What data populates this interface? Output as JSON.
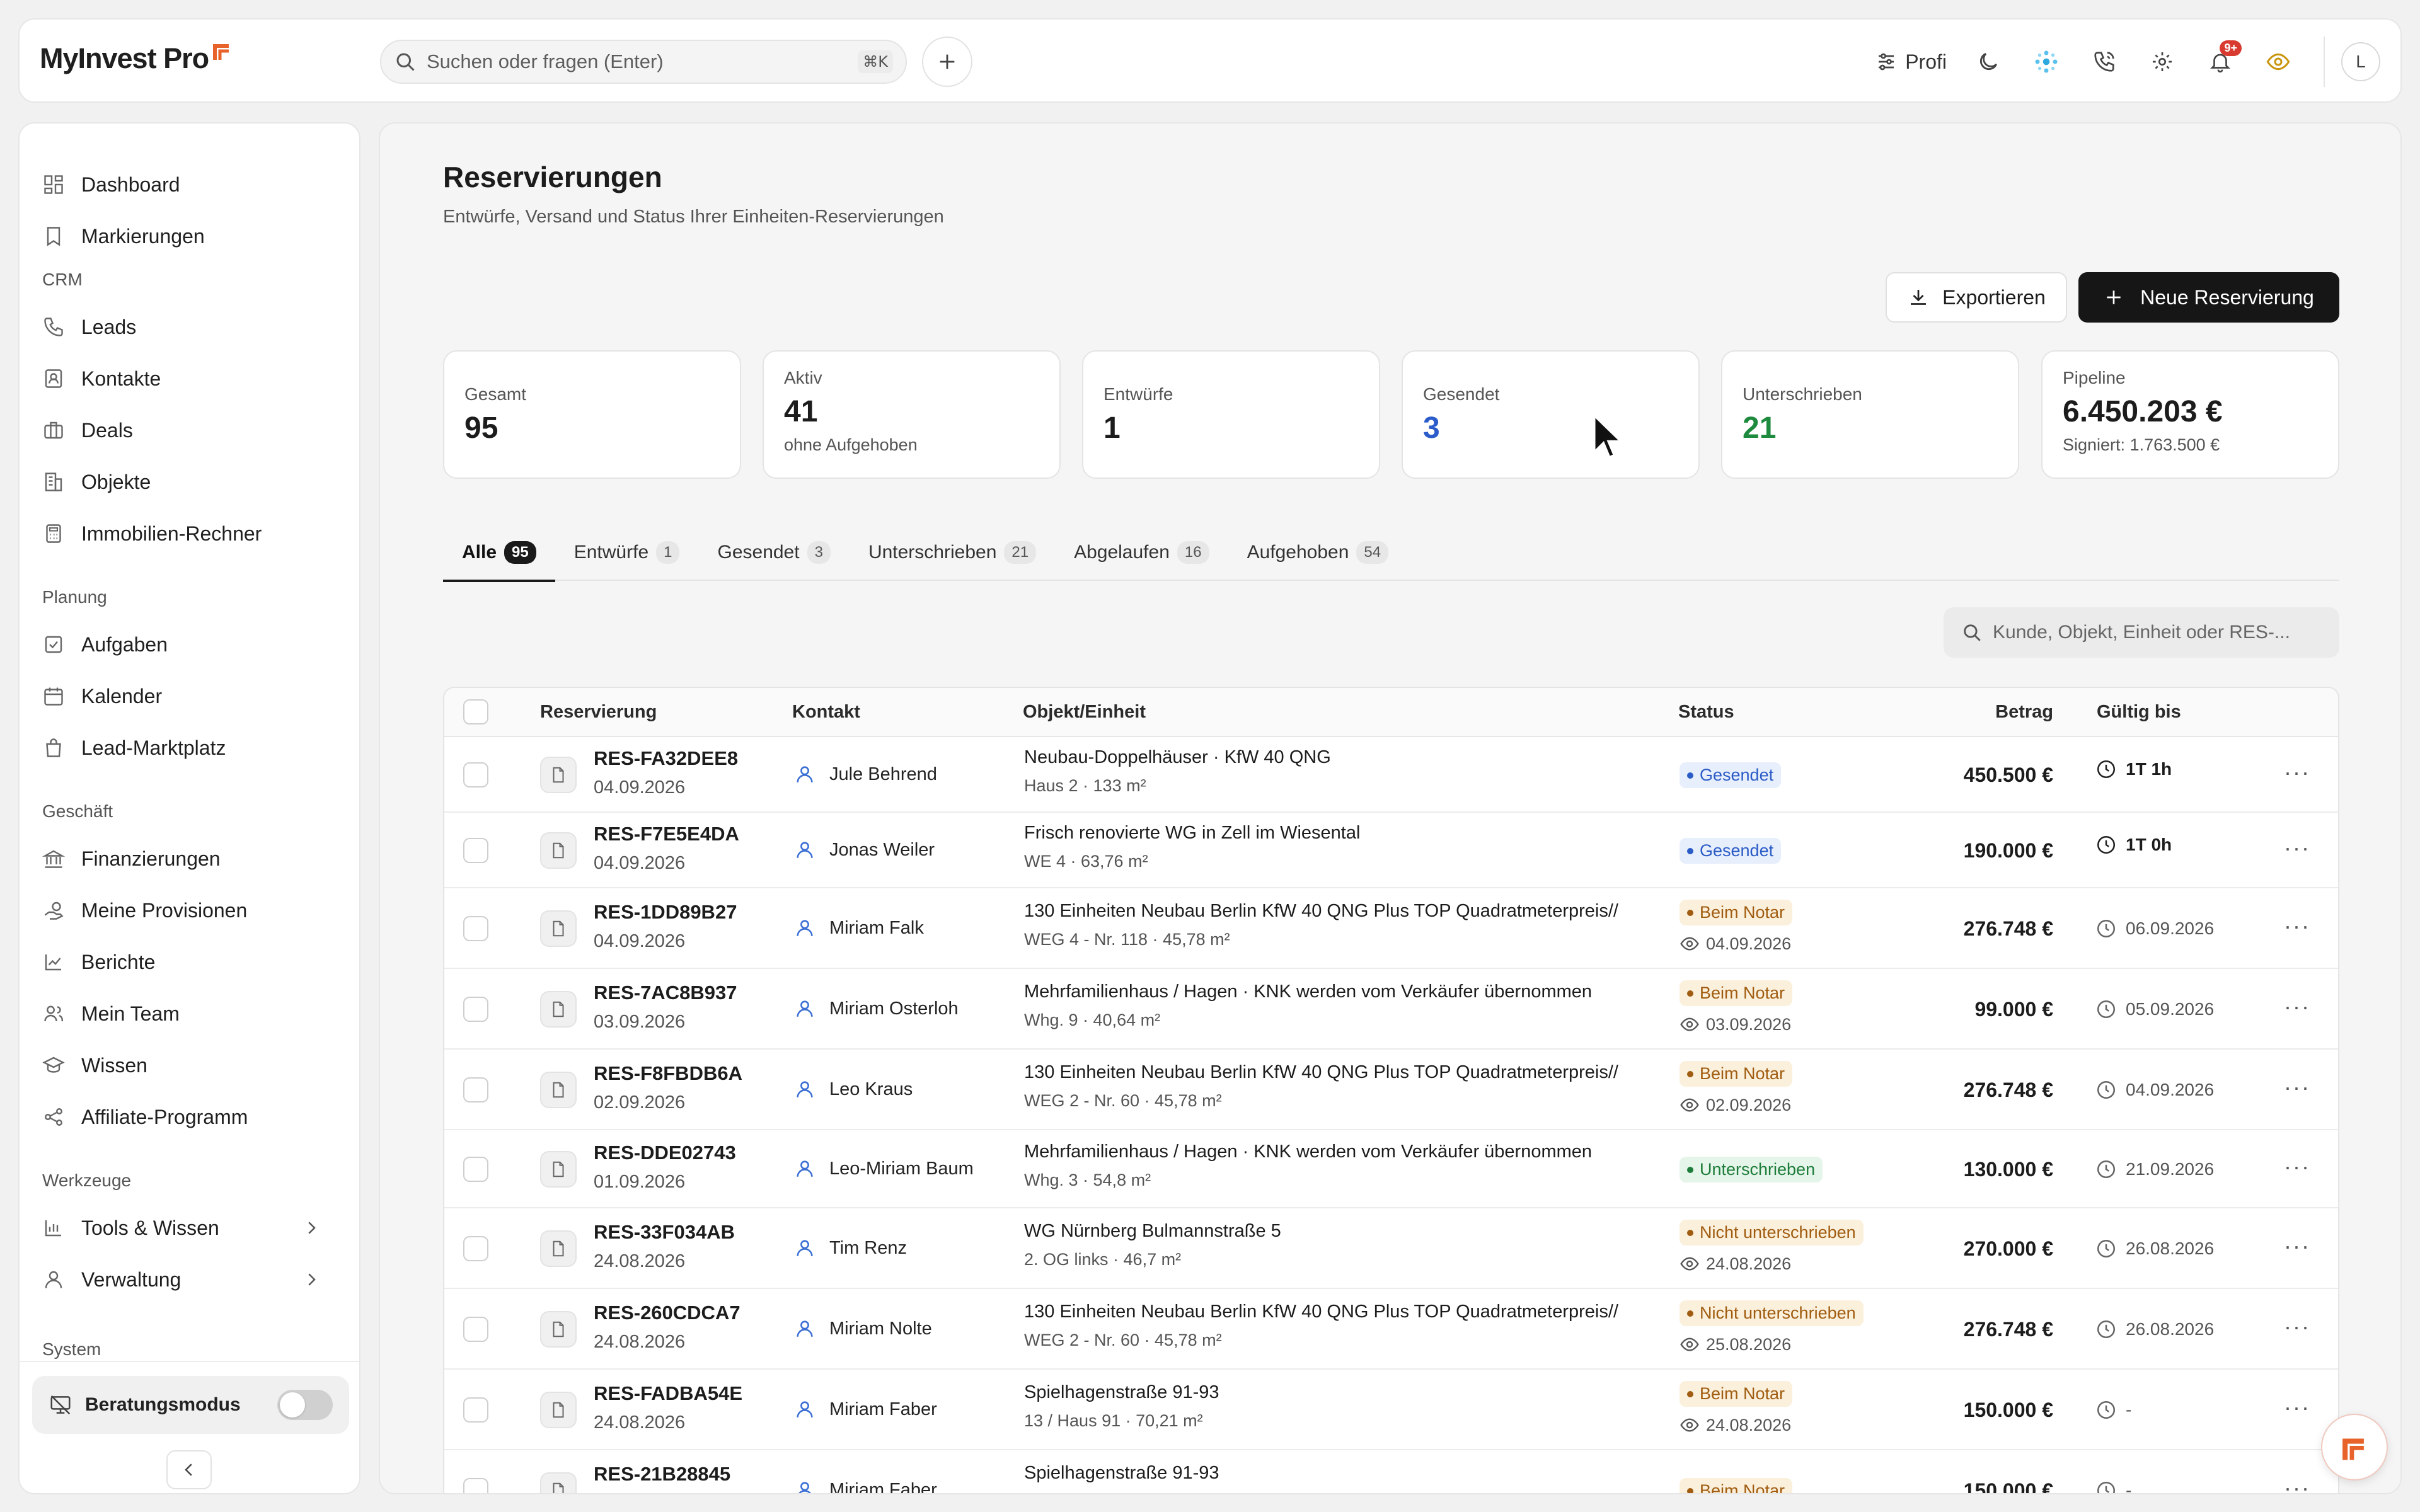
{
  "app": {
    "logo_text": "MyInvest Pro",
    "accent": "#e8632a"
  },
  "header": {
    "search_placeholder": "Suchen oder fragen (Enter)",
    "search_shortcut": "⌘K",
    "profi_label": "Profi",
    "notification_badge": "9+",
    "avatar_initial": "L"
  },
  "sidebar": {
    "items_top": [
      {
        "label": "Dashboard",
        "icon": "dashboard-icon"
      },
      {
        "label": "Markierungen",
        "icon": "bookmark-icon"
      }
    ],
    "sections": [
      {
        "title": "CRM",
        "items": [
          "Leads",
          "Kontakte",
          "Deals",
          "Objekte",
          "Immobilien-Rechner"
        ]
      },
      {
        "title": "Planung",
        "items": [
          "Aufgaben",
          "Kalender",
          "Lead-Marktplatz"
        ]
      },
      {
        "title": "Geschäft",
        "items": [
          "Finanzierungen",
          "Meine Provisionen",
          "Berichte",
          "Mein Team",
          "Wissen",
          "Affiliate-Programm"
        ]
      },
      {
        "title": "Werkzeuge",
        "items": [
          "Tools & Wissen",
          "Verwaltung"
        ]
      },
      {
        "title": "System",
        "items": []
      }
    ],
    "beratungsmodus_label": "Beratungsmodus",
    "beratungsmodus_on": false
  },
  "main": {
    "title": "Reservierungen",
    "subtitle": "Entwürfe, Versand und Status Ihrer Einheiten-Reservierungen",
    "export_label": "Exportieren",
    "new_label": "Neue Reservierung",
    "stats": [
      {
        "label": "Gesamt",
        "value": "95",
        "hint": ""
      },
      {
        "label": "Aktiv",
        "value": "41",
        "hint": "ohne Aufgehoben"
      },
      {
        "label": "Entwürfe",
        "value": "1",
        "hint": ""
      },
      {
        "label": "Gesendet",
        "value": "3",
        "hint": ""
      },
      {
        "label": "Unterschrieben",
        "value": "21",
        "hint": ""
      },
      {
        "label": "Pipeline",
        "value": "6.450.203 €",
        "hint": "Signiert: 1.763.500 €"
      }
    ],
    "tabs": [
      {
        "label": "Alle",
        "count": "95"
      },
      {
        "label": "Entwürfe",
        "count": "1"
      },
      {
        "label": "Gesendet",
        "count": "3"
      },
      {
        "label": "Unterschrieben",
        "count": "21"
      },
      {
        "label": "Abgelaufen",
        "count": "16"
      },
      {
        "label": "Aufgehoben",
        "count": "54"
      }
    ],
    "table_search_placeholder": "Kunde, Objekt, Einheit oder RES-...",
    "columns": {
      "reservierung": "Reservierung",
      "kontakt": "Kontakt",
      "objekt": "Objekt/Einheit",
      "status": "Status",
      "betrag": "Betrag",
      "gueltig": "Gültig bis"
    },
    "rows": [
      {
        "id": "RES-FA32DEE8",
        "date": "04.09.2026",
        "contact": "Jule Behrend",
        "object": "Neubau-Doppelhäuser · KfW 40 QNG",
        "unit": "Haus 2 · 133 m²",
        "status": "Gesendet",
        "status_date": "",
        "amount": "450.500 €",
        "valid": "1T 1h"
      },
      {
        "id": "RES-F7E5E4DA",
        "date": "04.09.2026",
        "contact": "Jonas Weiler",
        "object": "Frisch renovierte WG in Zell im Wiesental",
        "unit": "WE 4 · 63,76 m²",
        "status": "Gesendet",
        "status_date": "",
        "amount": "190.000 €",
        "valid": "1T 0h"
      },
      {
        "id": "RES-1DD89B27",
        "date": "04.09.2026",
        "contact": "Miriam Falk",
        "object": "130 Einheiten Neubau Berlin KfW 40 QNG Plus TOP Quadratmeterpreis//",
        "unit": "WEG 4 - Nr. 118 · 45,78 m²",
        "status": "Beim Notar",
        "status_date": "04.09.2026",
        "amount": "276.748 €",
        "valid": "06.09.2026"
      },
      {
        "id": "RES-7AC8B937",
        "date": "03.09.2026",
        "contact": "Miriam Osterloh",
        "object": "Mehrfamilienhaus / Hagen · KNK werden vom Verkäufer übernommen",
        "unit": "Whg. 9 · 40,64 m²",
        "status": "Beim Notar",
        "status_date": "03.09.2026",
        "amount": "99.000 €",
        "valid": "05.09.2026"
      },
      {
        "id": "RES-F8FBDB6A",
        "date": "02.09.2026",
        "contact": "Leo Kraus",
        "object": "130 Einheiten Neubau Berlin KfW 40 QNG Plus TOP Quadratmeterpreis//",
        "unit": "WEG 2 - Nr. 60 · 45,78 m²",
        "status": "Beim Notar",
        "status_date": "02.09.2026",
        "amount": "276.748 €",
        "valid": "04.09.2026"
      },
      {
        "id": "RES-DDE02743",
        "date": "01.09.2026",
        "contact": "Leo-Miriam Baum",
        "object": "Mehrfamilienhaus / Hagen · KNK werden vom Verkäufer übernommen",
        "unit": "Whg. 3 · 54,8 m²",
        "status": "Unterschrieben",
        "status_date": "",
        "amount": "130.000 €",
        "valid": "21.09.2026"
      },
      {
        "id": "RES-33F034AB",
        "date": "24.08.2026",
        "contact": "Tim Renz",
        "object": "WG Nürnberg Bulmannstraße 5",
        "unit": "2. OG links · 46,7 m²",
        "status": "Nicht unterschrieben",
        "status_date": "24.08.2026",
        "amount": "270.000 €",
        "valid": "26.08.2026"
      },
      {
        "id": "RES-260CDCA7",
        "date": "24.08.2026",
        "contact": "Miriam Nolte",
        "object": "130 Einheiten Neubau Berlin KfW 40 QNG Plus TOP Quadratmeterpreis//",
        "unit": "WEG 2 - Nr. 60 · 45,78 m²",
        "status": "Nicht unterschrieben",
        "status_date": "25.08.2026",
        "amount": "276.748 €",
        "valid": "26.08.2026"
      },
      {
        "id": "RES-FADBA54E",
        "date": "24.08.2026",
        "contact": "Miriam Faber",
        "object": "Spielhagenstraße 91-93",
        "unit": "13 / Haus 91 · 70,21 m²",
        "status": "Beim Notar",
        "status_date": "24.08.2026",
        "amount": "150.000 €",
        "valid": "-"
      },
      {
        "id": "RES-21B28845",
        "date": "",
        "contact": "Miriam Faber",
        "object": "Spielhagenstraße 91-93",
        "unit": "",
        "status": "Beim Notar",
        "status_date": "",
        "amount": "150.000 €",
        "valid": "-"
      }
    ]
  }
}
